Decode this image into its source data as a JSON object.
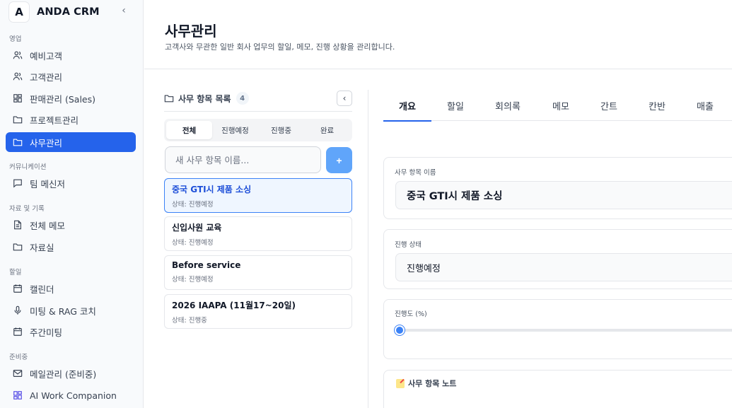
{
  "brand": {
    "logo": "A",
    "name": "ANDA CRM"
  },
  "sidebar": {
    "sections": [
      {
        "title": "영업",
        "items": [
          {
            "label": "예비고객",
            "icon": "users-icon"
          },
          {
            "label": "고객관리",
            "icon": "users-icon"
          },
          {
            "label": "판매관리 (Sales)",
            "icon": "dashboard-icon"
          },
          {
            "label": "프로젝트관리",
            "icon": "folder-icon"
          },
          {
            "label": "사무관리",
            "icon": "folder-icon",
            "active": true
          }
        ]
      },
      {
        "title": "커뮤니케이션",
        "items": [
          {
            "label": "팀 메신저",
            "icon": "message-icon"
          }
        ]
      },
      {
        "title": "자료 및 기록",
        "items": [
          {
            "label": "전체 메모",
            "icon": "file-icon"
          },
          {
            "label": "자료실",
            "icon": "folder-icon"
          }
        ]
      },
      {
        "title": "할일",
        "items": [
          {
            "label": "캘린더",
            "icon": "calendar-icon"
          },
          {
            "label": "미팅 & RAG 코치",
            "icon": "mic-icon"
          },
          {
            "label": "주간미팅",
            "icon": "calendar-icon"
          }
        ]
      },
      {
        "title": "준비중",
        "items": [
          {
            "label": "메일관리 (준비중)",
            "icon": "mail-icon"
          },
          {
            "label": "AI Work Companion",
            "icon": "dashboard-icon"
          }
        ]
      }
    ]
  },
  "header": {
    "title": "사무관리",
    "subtitle": "고객사와 무관한 일반 회사 업무의 할일, 메모, 진행 상황을 관리합니다."
  },
  "list": {
    "title": "사무 항목 목록",
    "count": "4",
    "filters": [
      "전체",
      "진행예정",
      "진행중",
      "완료"
    ],
    "active_filter": "전체",
    "new_placeholder": "새 사무 항목 이름...",
    "add_label": "+",
    "items": [
      {
        "name": "중국 GTI시 제품 소싱",
        "status": "상태: 진행예정",
        "active": true
      },
      {
        "name": "신입사원 교육",
        "status": "상태: 진행예정"
      },
      {
        "name": "Before service",
        "status": "상태: 진행예정"
      },
      {
        "name": "2026 IAAPA (11월17~20일)",
        "status": "상태: 진행중"
      }
    ]
  },
  "detail": {
    "tabs": [
      "개요",
      "할일",
      "회의록",
      "메모",
      "간트",
      "칸반",
      "매출"
    ],
    "active_tab": "개요",
    "name_label": "사무 항목 이름",
    "name_value": "중국 GTI시 제품 소싱",
    "status_label": "진행 상태",
    "status_value": "진행예정",
    "progress_label": "진행도 (%)",
    "progress_value": 0,
    "note_title": "사무 항목 노트"
  },
  "colors": {
    "accent": "#2563eb",
    "accent_light": "#60a5fa"
  }
}
